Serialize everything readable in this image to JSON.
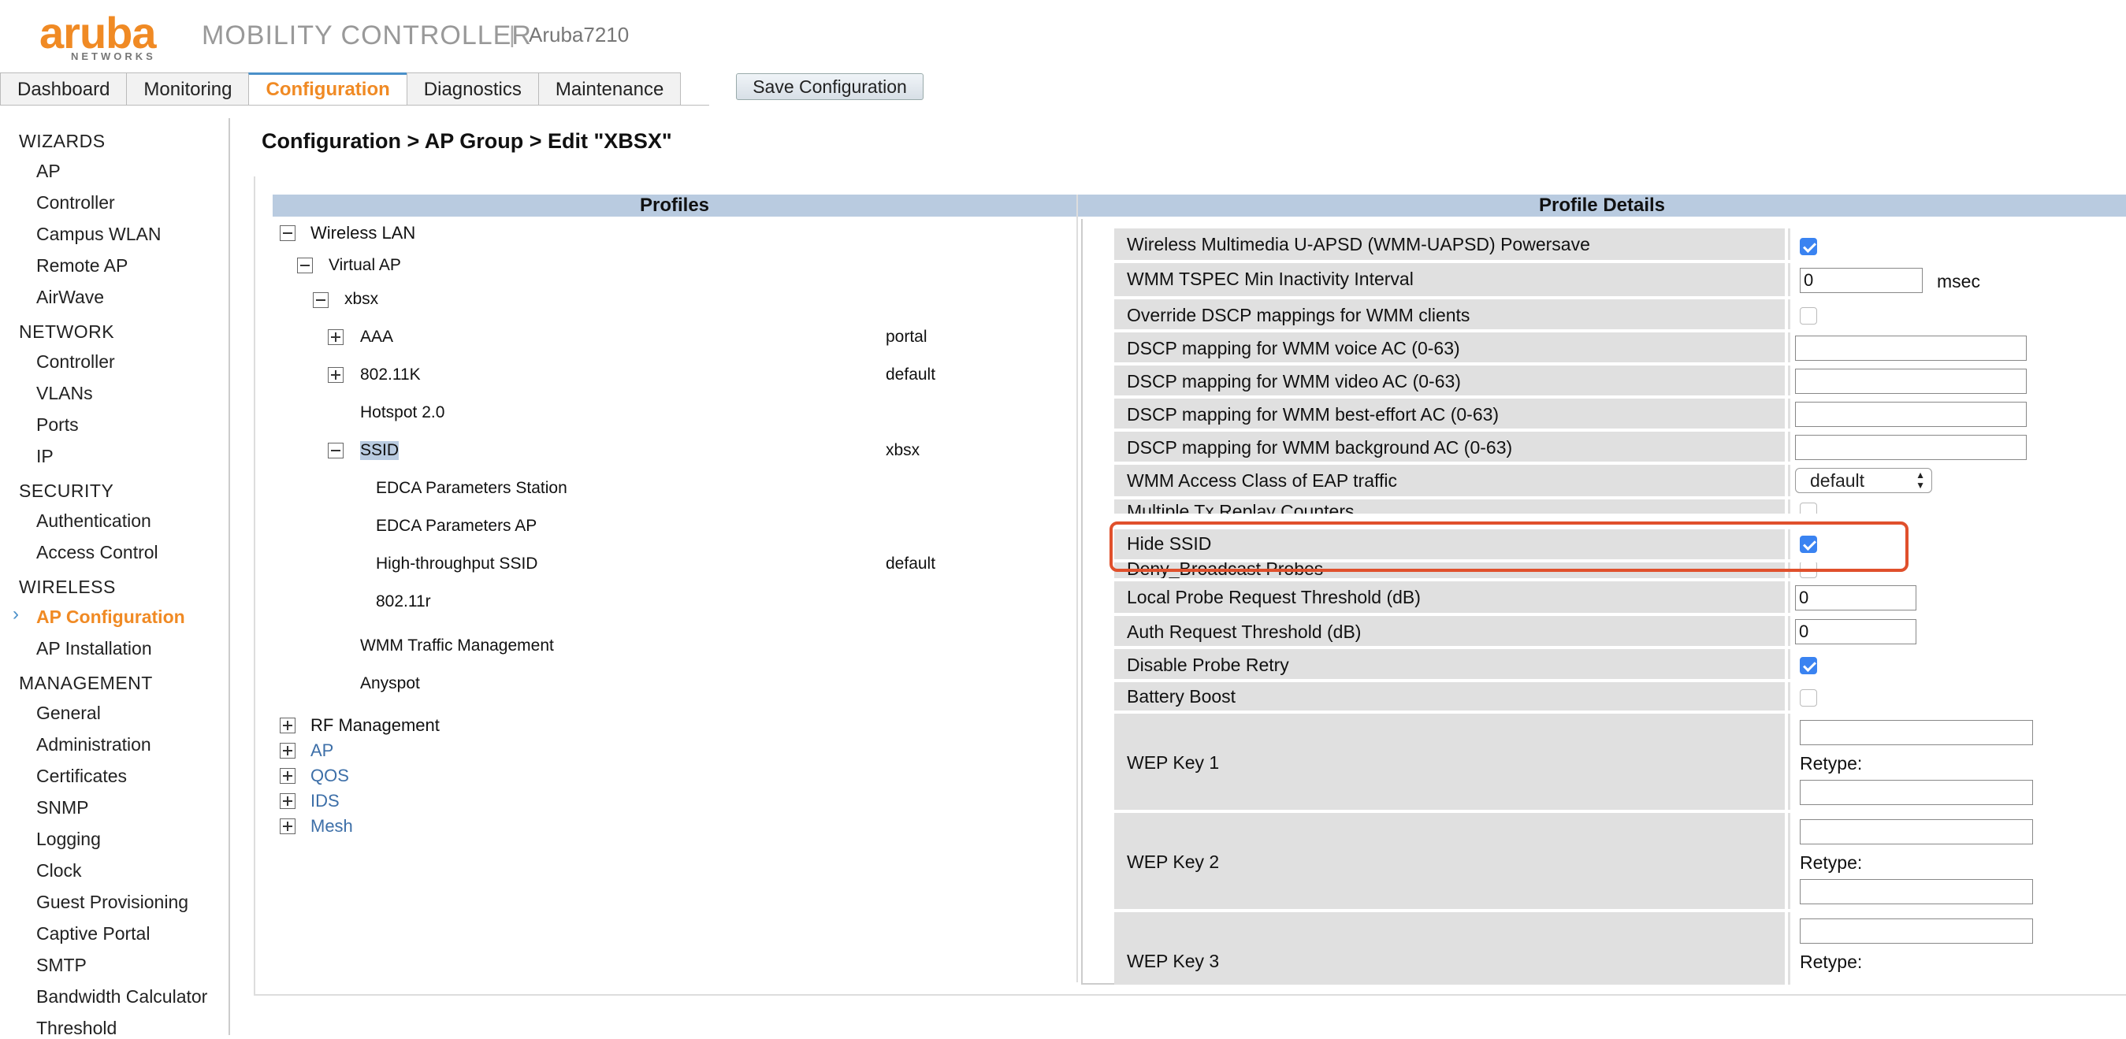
{
  "header": {
    "logo_text": "aruba",
    "logo_sub": "NETWORKS",
    "app_title": "MOBILITY CONTROLLER",
    "separator": "|",
    "device": "Aruba7210"
  },
  "tabs": [
    "Dashboard",
    "Monitoring",
    "Configuration",
    "Diagnostics",
    "Maintenance"
  ],
  "active_tab": "Configuration",
  "save_button": "Save Configuration",
  "sidebar": {
    "sections": [
      {
        "title": "WIZARDS",
        "items": [
          "AP",
          "Controller",
          "Campus WLAN",
          "Remote AP",
          "AirWave"
        ]
      },
      {
        "title": "NETWORK",
        "items": [
          "Controller",
          "VLANs",
          "Ports",
          "IP"
        ]
      },
      {
        "title": "SECURITY",
        "items": [
          "Authentication",
          "Access Control"
        ]
      },
      {
        "title": "WIRELESS",
        "items": [
          "AP Configuration",
          "AP Installation"
        ]
      },
      {
        "title": "MANAGEMENT",
        "items": [
          "General",
          "Administration",
          "Certificates",
          "SNMP",
          "Logging",
          "Clock",
          "Guest Provisioning",
          "Captive Portal",
          "SMTP",
          "Bandwidth Calculator",
          "Threshold"
        ]
      }
    ],
    "active_item": "AP Configuration"
  },
  "page_heading": "Configuration > AP Group > Edit \"XBSX\"",
  "profiles_header": "Profiles",
  "details_header": "Profile Details",
  "tree": {
    "wireless_lan": "Wireless LAN",
    "virtual_ap": "Virtual AP",
    "xbsx": "xbsx",
    "aaa": "AAA",
    "aaa_val": "portal",
    "k80211": "802.11K",
    "k80211_val": "default",
    "hotspot": "Hotspot 2.0",
    "ssid": "SSID",
    "ssid_val": "xbsx",
    "edca_station": "EDCA Parameters Station",
    "edca_ap": "EDCA Parameters AP",
    "ht_ssid": "High-throughput SSID",
    "ht_ssid_val": "default",
    "r80211": "802.11r",
    "wmm_traffic": "WMM Traffic Management",
    "anyspot": "Anyspot",
    "rf_mgmt": "RF Management",
    "ap": "AP",
    "qos": "QOS",
    "ids": "IDS",
    "mesh": "Mesh"
  },
  "details": {
    "wmm_uapsd": "Wireless Multimedia U-APSD (WMM-UAPSD) Powersave",
    "wmm_tspec": "WMM TSPEC Min Inactivity Interval",
    "wmm_tspec_val": "0",
    "wmm_tspec_unit": "msec",
    "override_dscp": "Override DSCP mappings for WMM clients",
    "dscp_voice": "DSCP mapping for WMM voice AC (0-63)",
    "dscp_video": "DSCP mapping for WMM video AC (0-63)",
    "dscp_be": "DSCP mapping for WMM best-effort AC (0-63)",
    "dscp_bg": "DSCP mapping for WMM background AC (0-63)",
    "wmm_eap": "WMM Access Class of EAP traffic",
    "wmm_eap_val": "default",
    "multi_tx": "Multiple Tx Replay Counters",
    "hide_ssid": "Hide SSID",
    "deny_bcast": "Deny_Broadcast Probes",
    "local_probe": "Local Probe Request Threshold (dB)",
    "local_probe_val": "0",
    "auth_req": "Auth Request Threshold (dB)",
    "auth_req_val": "0",
    "disable_probe": "Disable Probe Retry",
    "battery": "Battery Boost",
    "wep1": "WEP Key 1",
    "wep2": "WEP Key 2",
    "wep3": "WEP Key 3",
    "retype": "Retype:"
  },
  "checkbox_states": {
    "wmm_uapsd": true,
    "override_dscp": false,
    "multi_tx": false,
    "hide_ssid": true,
    "deny_bcast": false,
    "disable_probe": true,
    "battery": false
  },
  "colors": {
    "brand_orange": "#f08a24",
    "header_blue": "#b9cbe0",
    "highlight_red": "#e0502c",
    "checkbox_blue": "#3a83f1"
  }
}
